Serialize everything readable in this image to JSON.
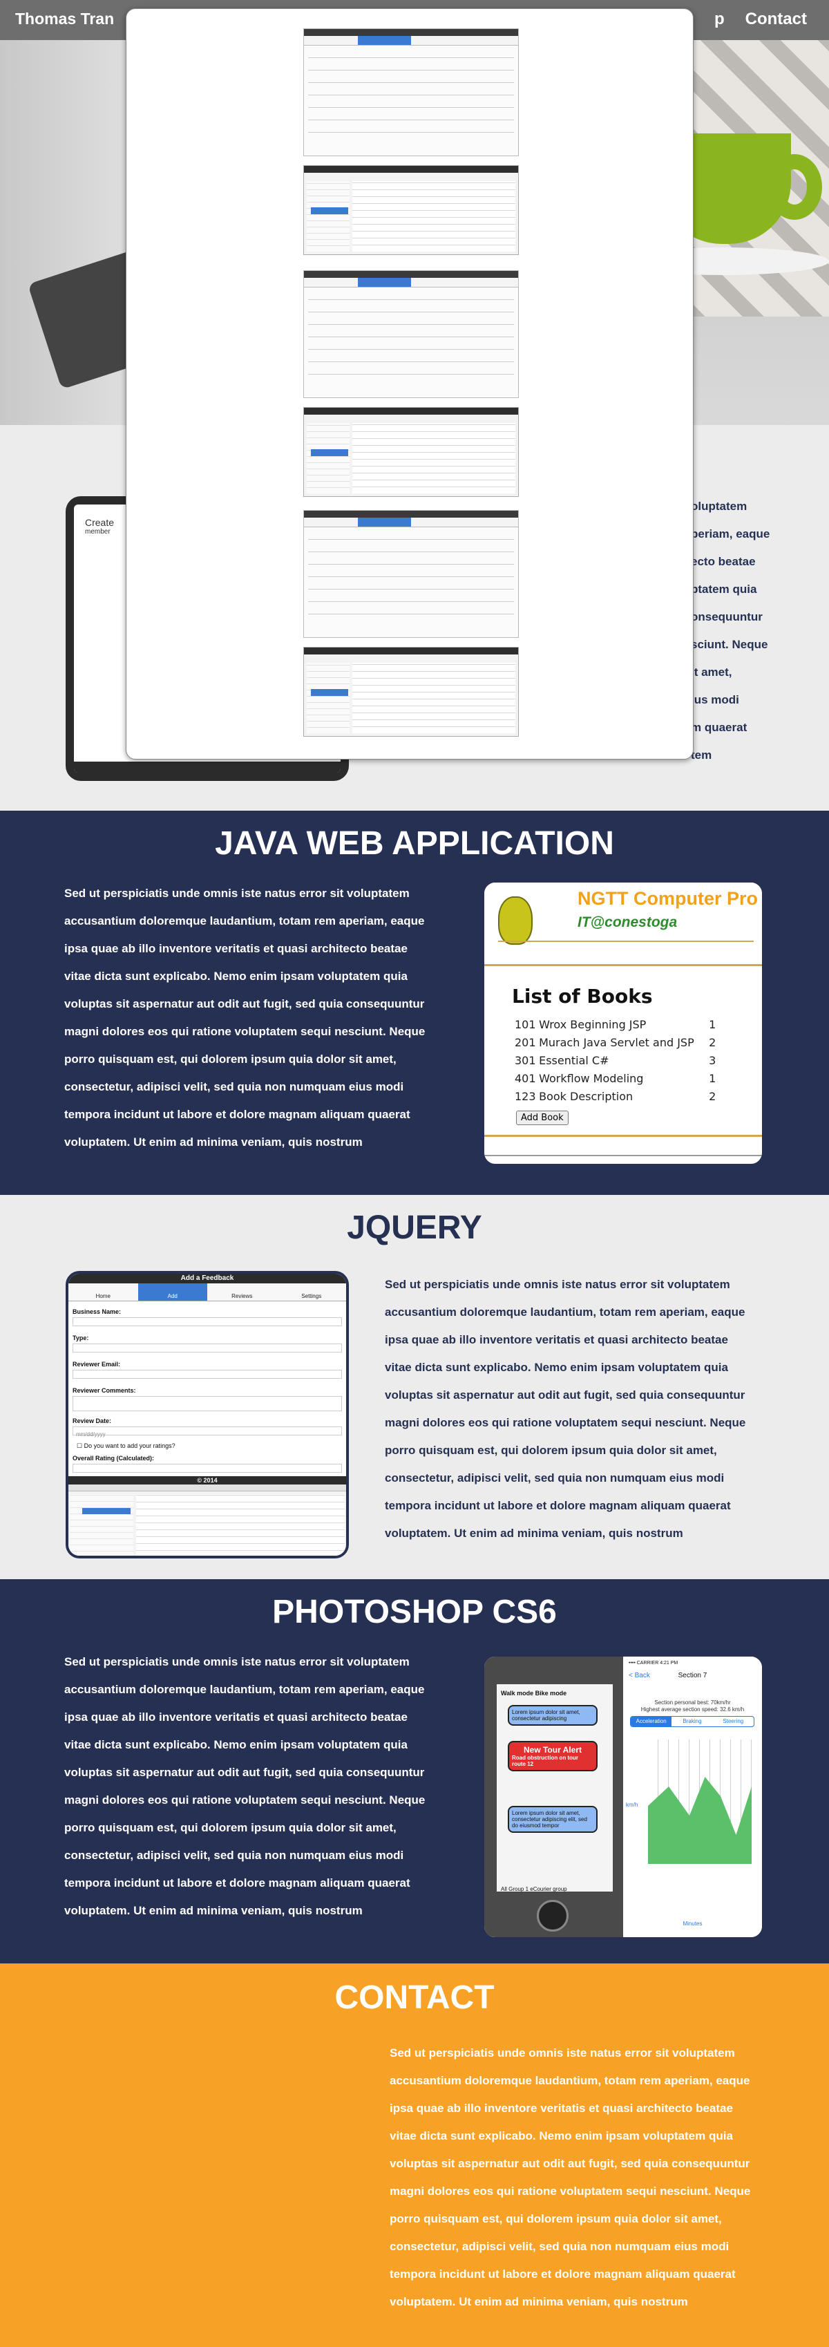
{
  "navbar": {
    "brand": "Thomas Tran",
    "links": [
      "p",
      "Contact"
    ]
  },
  "about": {
    "paragraph_lines": [
      "oluptatem",
      "periam, eaque",
      "ecto beatae",
      "ptatem quia",
      "onsequuntur",
      "sciunt. Neque",
      "it amet,",
      "ius modi",
      "m quaerat",
      "tem"
    ],
    "phone": {
      "title": "Create",
      "subtitle": "member"
    }
  },
  "modal": {
    "shots": [
      "shot-1",
      "shot-2",
      "shot-3"
    ]
  },
  "sections": {
    "java": {
      "title": "JAVA WEB APPLICATION"
    },
    "jquery": {
      "title": "JQUERY"
    },
    "photoshop": {
      "title": "PHOTOSHOP CS6"
    },
    "contact": {
      "title": "CONTACT"
    }
  },
  "lorem": {
    "lines": [
      "Sed ut perspiciatis unde omnis iste natus error sit voluptatem",
      "accusantium doloremque laudantium, totam rem aperiam, eaque",
      "ipsa quae ab illo inventore veritatis et quasi architecto beatae",
      "vitae dicta sunt explicabo. Nemo enim ipsam voluptatem quia",
      "voluptas sit aspernatur aut odit aut fugit, sed quia consequuntur",
      "magni dolores eos qui ratione voluptatem sequi nesciunt. Neque",
      "porro quisquam est, qui dolorem ipsum quia dolor sit amet,",
      "consectetur, adipisci velit, sed quia non numquam eius modi",
      "tempora incidunt ut labore et dolore magnam aliquam quaerat",
      "voluptatem. Ut enim ad minima veniam, quis nostrum"
    ]
  },
  "jsp": {
    "header": "NGTT Computer Pro",
    "subheader": "IT@conestoga",
    "list_title": "List of Books",
    "books": [
      {
        "id": "101",
        "title": "Wrox Beginning JSP",
        "qty": "1"
      },
      {
        "id": "201",
        "title": "Murach Java Servlet and JSP",
        "qty": "2"
      },
      {
        "id": "301",
        "title": "Essential C#",
        "qty": "3"
      },
      {
        "id": "401",
        "title": "Workflow Modeling",
        "qty": "1"
      },
      {
        "id": "123",
        "title": "Book Description",
        "qty": "2"
      }
    ],
    "add_button": "Add Book"
  },
  "feedback": {
    "title": "Add a Feedback",
    "tabs": [
      "Home",
      "Add",
      "Reviews",
      "Settings"
    ],
    "labels": {
      "business": "Business Name:",
      "type": "Type:",
      "email": "Reviewer Email:",
      "comments": "Reviewer Comments:",
      "date": "Review Date:",
      "rating": "Overall Rating (Calculated):"
    },
    "date_placeholder": "mm/dd/yyyy",
    "checkbox": "Do you want to add your ratings?",
    "footer": "© 2014"
  },
  "photoshop_mock": {
    "toggle": "Walk mode    Bike mode",
    "bubble1": "Lorem ipsum dolor sit amet, consectetur adipiscing",
    "alert_title": "New Tour Alert",
    "alert_body": "Road obstruction on tour route 12",
    "bubble3": "Lorem ipsum dolor sit amet, consectetur adipiscing elit, sed do eiusmod tempor",
    "bottom_bar": "All  Group 1  eCourier group",
    "ios_status": "•••• CARRIER   4:21 PM",
    "back": "< Back",
    "section": "Section 7",
    "legend1": "Section personal best: 70km/hr",
    "legend2": "Highest average section speed: 32.6 km/h",
    "segments": [
      "Acceleration",
      "Braking",
      "Steering"
    ],
    "ylabel": "km/h",
    "xlabel": "Minutes"
  }
}
